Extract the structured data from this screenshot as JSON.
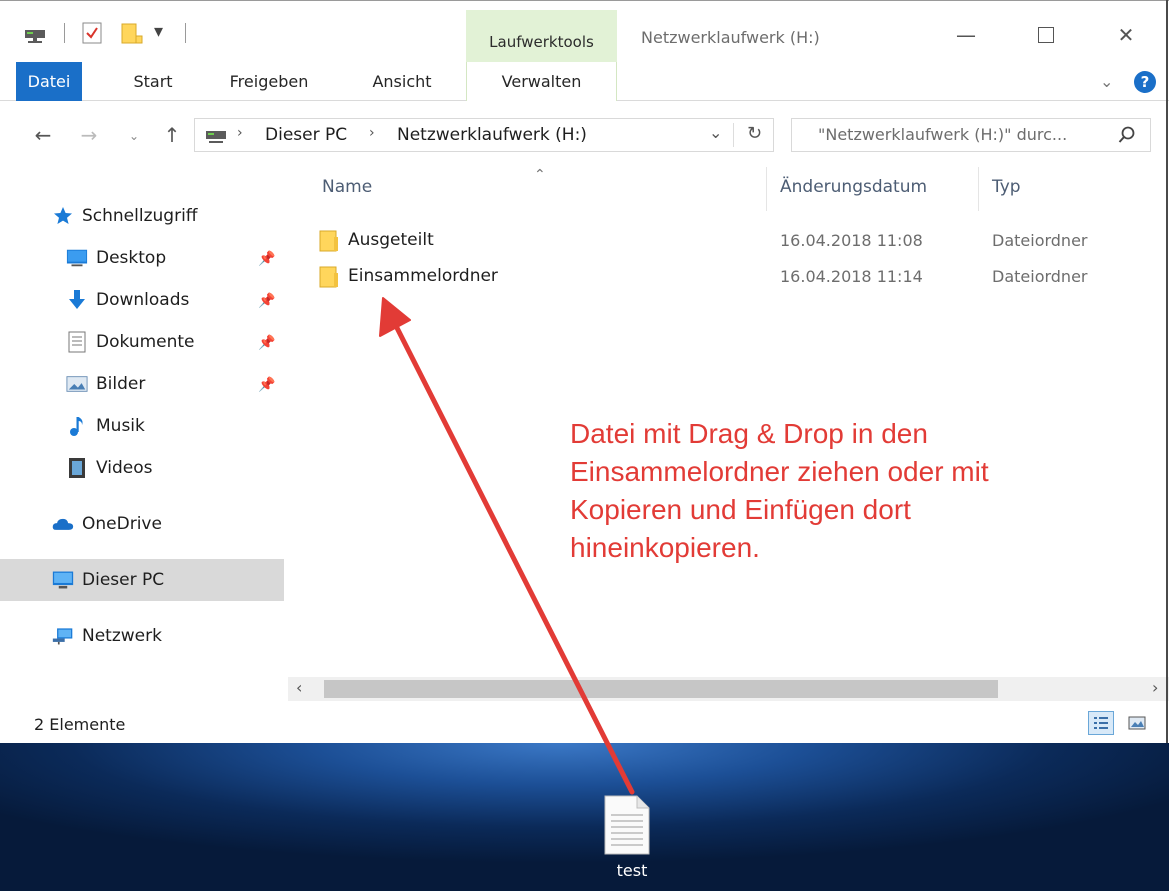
{
  "titlebar": {
    "context_group": "Laufwerktools",
    "window_title": "Netzwerklaufwerk (H:)"
  },
  "ribbon": {
    "tabs": [
      "Datei",
      "Start",
      "Freigeben",
      "Ansicht",
      "Verwalten"
    ]
  },
  "address": {
    "crumbs": [
      "Dieser PC",
      "Netzwerklaufwerk (H:)"
    ],
    "search_placeholder": "\"Netzwerklaufwerk (H:)\" durc..."
  },
  "nav": {
    "quick_access": "Schnellzugriff",
    "items": [
      {
        "label": "Desktop",
        "icon": "desktop-icon",
        "pinned": true
      },
      {
        "label": "Downloads",
        "icon": "download-icon",
        "pinned": true
      },
      {
        "label": "Dokumente",
        "icon": "document-icon",
        "pinned": true
      },
      {
        "label": "Bilder",
        "icon": "pictures-icon",
        "pinned": true
      },
      {
        "label": "Musik",
        "icon": "music-icon",
        "pinned": false
      },
      {
        "label": "Videos",
        "icon": "video-icon",
        "pinned": false
      }
    ],
    "onedrive": "OneDrive",
    "this_pc": "Dieser PC",
    "network": "Netzwerk"
  },
  "filelist": {
    "columns": {
      "name": "Name",
      "date": "Änderungsdatum",
      "type": "Typ"
    },
    "rows": [
      {
        "name": "Ausgeteilt",
        "date": "16.04.2018 11:08",
        "type": "Dateiordner"
      },
      {
        "name": "Einsammelordner",
        "date": "16.04.2018 11:14",
        "type": "Dateiordner"
      }
    ]
  },
  "status": {
    "count": "2 Elemente"
  },
  "desktop": {
    "file_label": "test"
  },
  "annotation": {
    "lines": [
      "Datei mit Drag & Drop in den",
      "Einsammelordner ziehen oder mit",
      "Kopieren und Einfügen dort",
      "hineinkopieren."
    ]
  },
  "colors": {
    "accent": "#1a6fc8",
    "annotation": "#e23b36",
    "context_tab": "#e2f2d6"
  }
}
